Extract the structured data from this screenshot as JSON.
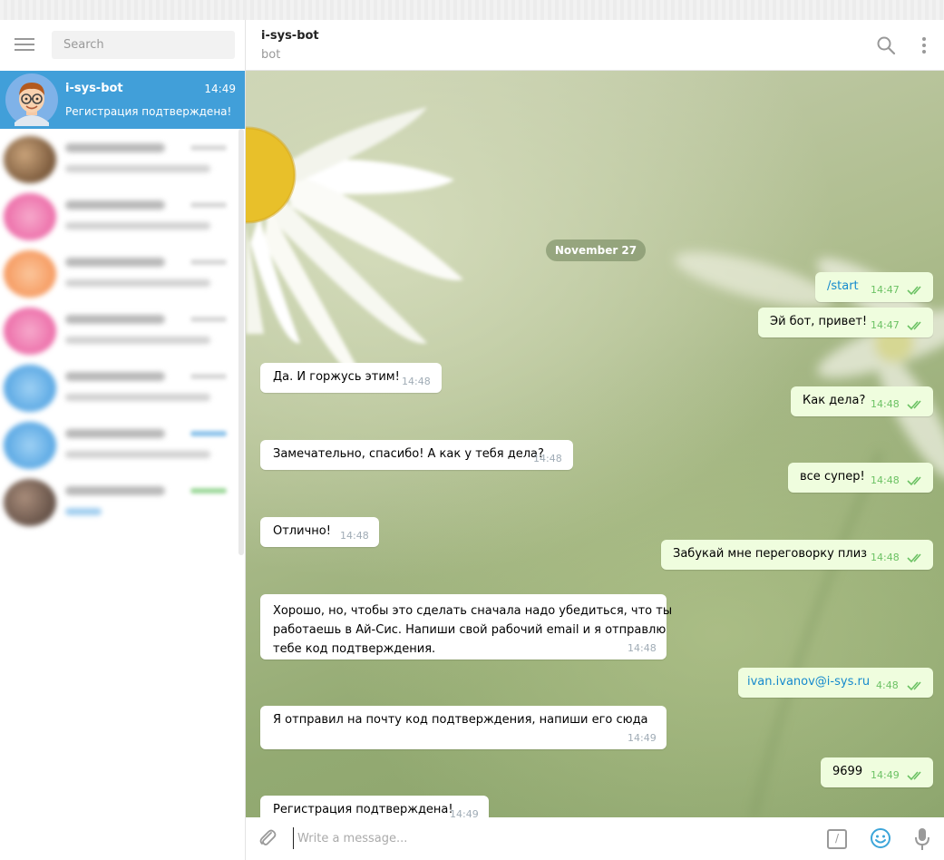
{
  "sidebar": {
    "search_placeholder": "Search",
    "active_chat": {
      "name": "i-sys-bot",
      "time": "14:49",
      "preview": "Регистрация подтверждена!"
    }
  },
  "chat": {
    "title": "i-sys-bot",
    "subtitle": "bot",
    "date_label": "November 27",
    "messages": [
      {
        "dir": "out",
        "text": "/start",
        "time": "14:47"
      },
      {
        "dir": "out",
        "text": "Эй бот, привет!",
        "time": "14:47"
      },
      {
        "dir": "in",
        "text": "Да. И горжусь этим!",
        "time": "14:48"
      },
      {
        "dir": "out",
        "text": "Как дела?",
        "time": "14:48"
      },
      {
        "dir": "in",
        "text": "Замечательно, спасибо! А как у тебя дела?",
        "time": "14:48"
      },
      {
        "dir": "out",
        "text": "все супер!",
        "time": "14:48"
      },
      {
        "dir": "in",
        "text": "Отлично!",
        "time": "14:48"
      },
      {
        "dir": "out",
        "text": "Забукай мне переговорку плиз",
        "time": "14:48"
      },
      {
        "dir": "in",
        "lines": [
          "Хорошо, но, чтобы это сделать сначала надо убедиться, что ты",
          "работаешь в Ай-Сис. Напиши свой рабочий email и я отправлю",
          "тебе код подтверждения."
        ],
        "time": "14:48"
      },
      {
        "dir": "out",
        "text": "ivan.ivanov@i-sys.ru",
        "time": "4:48"
      },
      {
        "dir": "in",
        "text": "Я отправил на почту код подтверждения, напиши его сюда",
        "time": "14:49"
      },
      {
        "dir": "out",
        "text": "9699",
        "time": "14:49"
      },
      {
        "dir": "in",
        "text": "Регистрация подтверждена!",
        "time": "14:49"
      }
    ]
  },
  "composer": {
    "placeholder": "Write a message...",
    "command_glyph": "/"
  }
}
